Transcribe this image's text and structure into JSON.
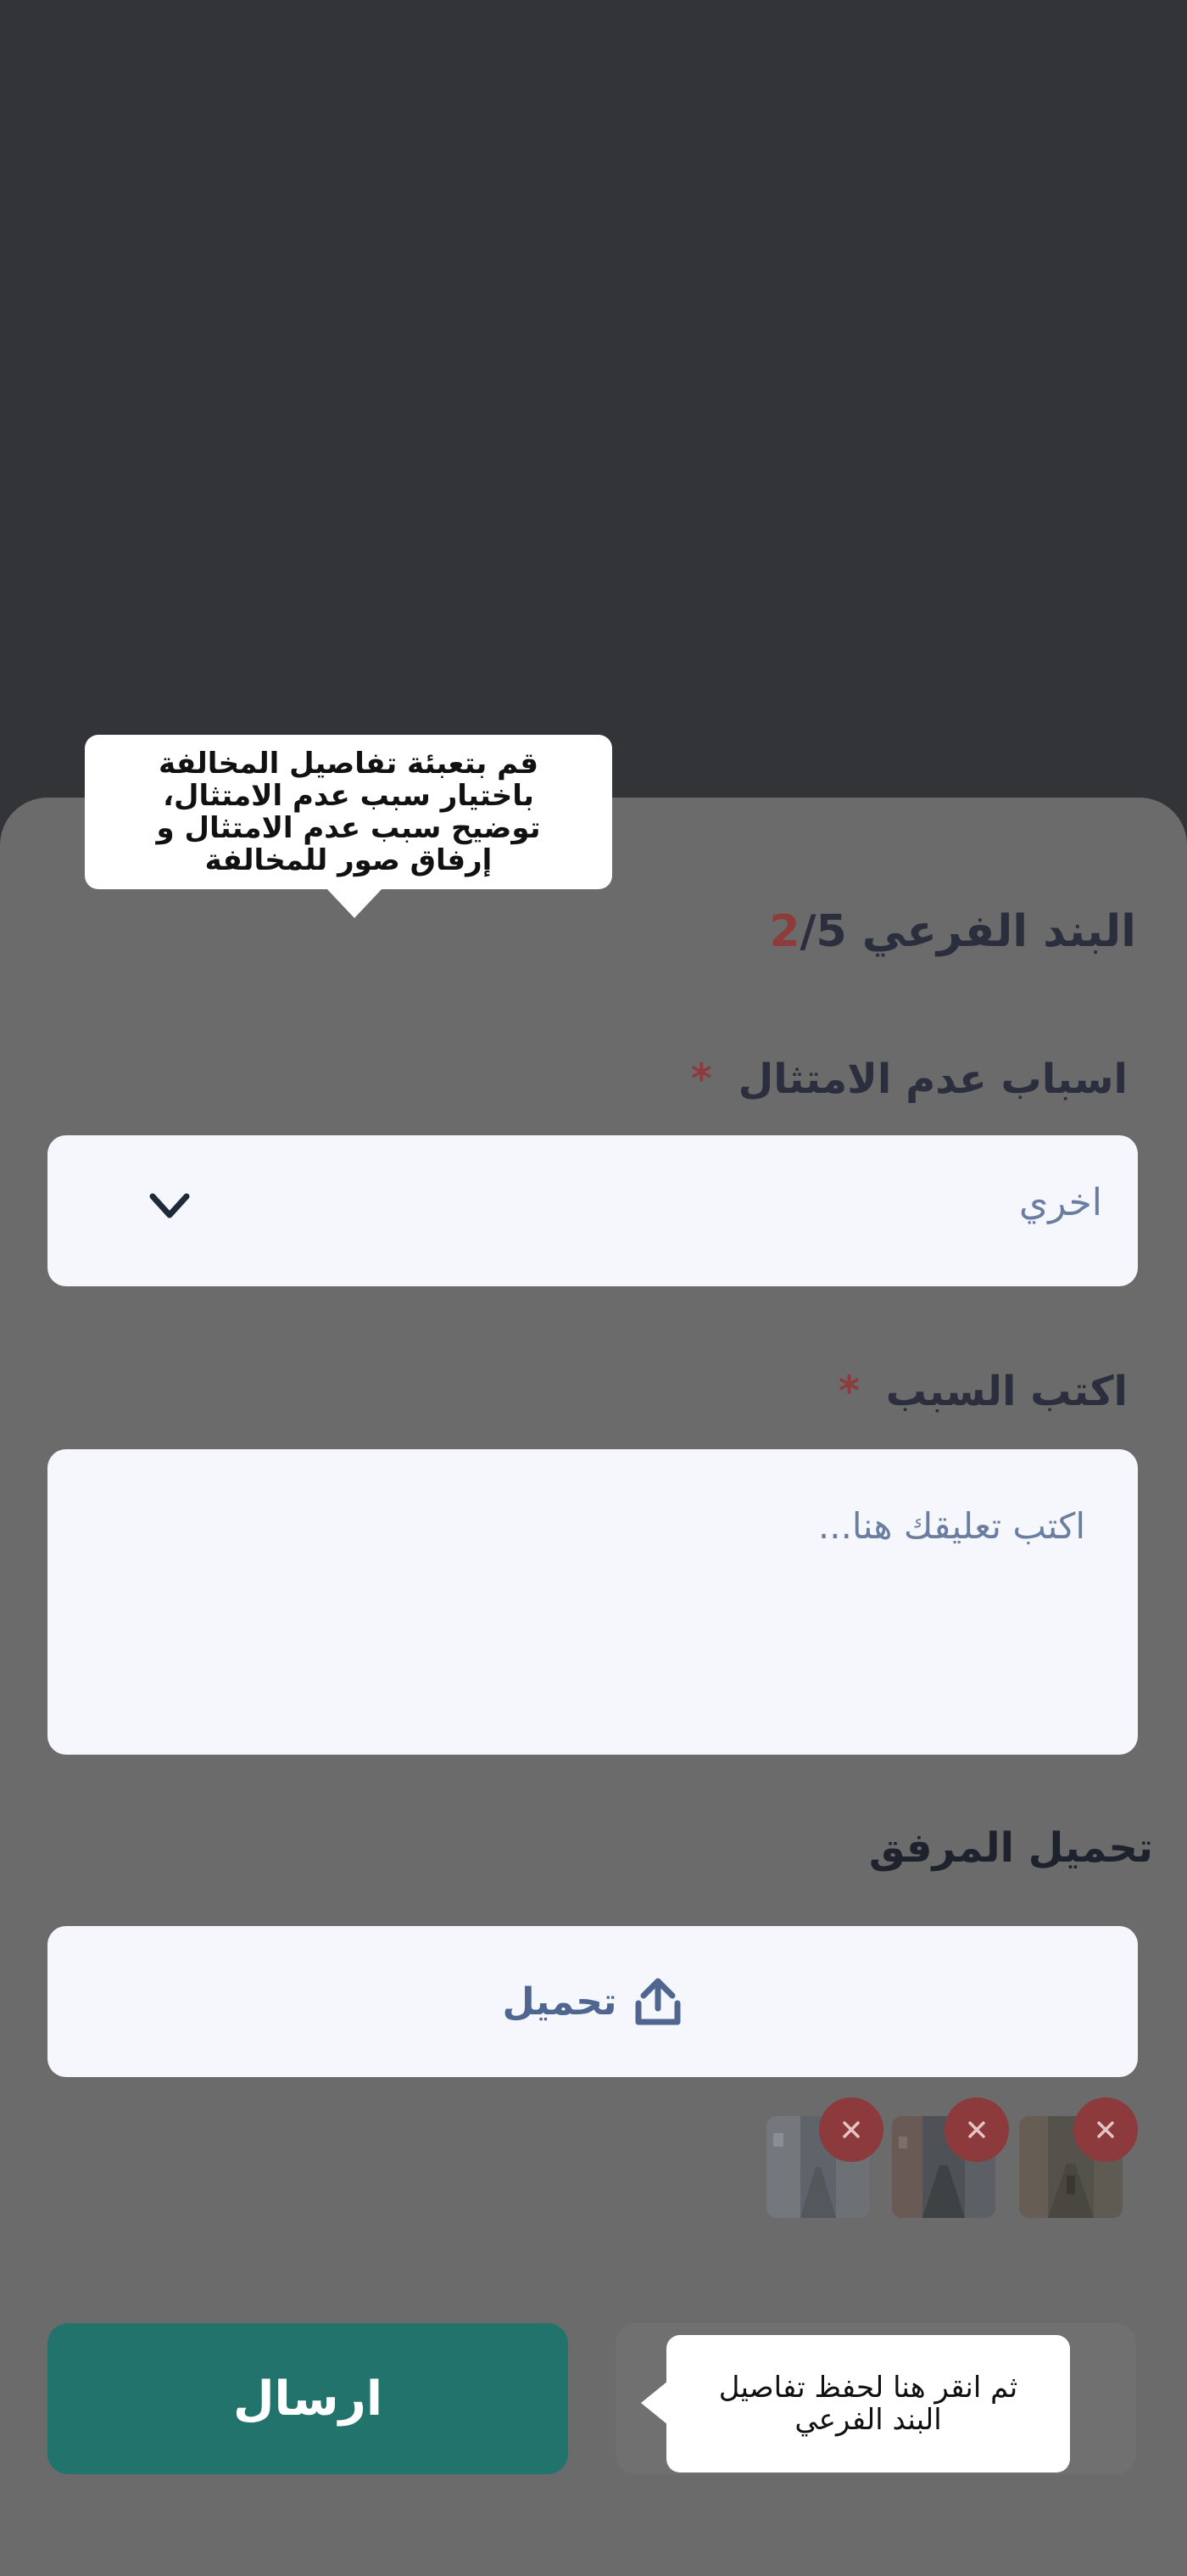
{
  "sheet": {
    "title_prefix": "البند الفرعي",
    "step_current": "2",
    "step_total": "/5"
  },
  "reason_field": {
    "label": "اسباب عدم الامتثال",
    "required_mark": "*",
    "selected_value": "اخري"
  },
  "reason_text": {
    "label": "اكتب السبب",
    "required_mark": "*",
    "placeholder": "اكتب تعليقك هنا..."
  },
  "attachments": {
    "title": "تحميل المرفق",
    "upload_label": "تحميل",
    "thumbnails": [
      "photo-1",
      "photo-2",
      "photo-3"
    ]
  },
  "actions": {
    "send_label": "ارسال"
  },
  "tooltips": {
    "top": "قم بتعبئة تفاصيل المخالفة باختيار سبب عدم الامتثال، توضيح سبب عدم الامتثال و إرفاق صور للمخالفة",
    "bottom": "ثم انقر هنا لحفظ تفاصيل البند الفرعي"
  },
  "colors": {
    "overlay": "#333438",
    "sheet_dimmed": "#6b6b6b",
    "field_bg": "#f5f7fc",
    "primary": "#22736c",
    "danger": "#8c3a3b",
    "title_text": "#2b2f3d"
  },
  "icons": [
    "chevron-down-icon",
    "upload-icon",
    "close-icon"
  ]
}
